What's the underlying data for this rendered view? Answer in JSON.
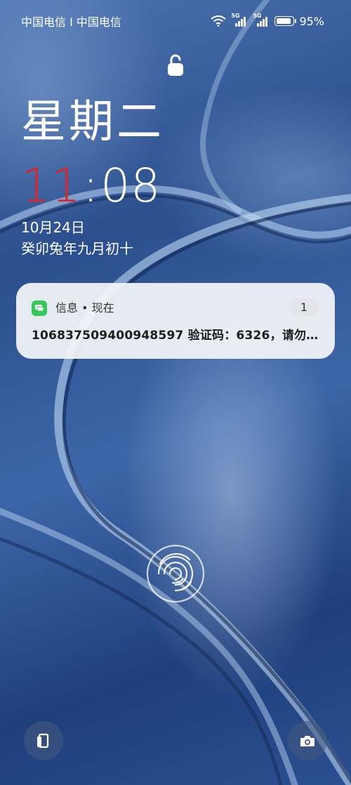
{
  "status_bar": {
    "carrier": "中国电信 I 中国电信",
    "signal_1_tag": "5G",
    "signal_2_tag": "5G",
    "battery_level": 0.95,
    "battery_text": "95%"
  },
  "lockscreen": {
    "weekday": "星期二",
    "time_hour": "11",
    "time_separator": ":",
    "time_minute": "08",
    "date": "10月24日",
    "lunar_date": "癸卯兔年九月初十"
  },
  "notification": {
    "app_name": "信息 • 现在",
    "count": "1",
    "text": "10683750940​0948597 验证码：6326，请勿…"
  },
  "shortcuts": {
    "left_icon": "wallet-card-icon",
    "right_icon": "camera-icon"
  },
  "colors": {
    "time_hour": "#d8262b",
    "messages_app": "#34c759"
  }
}
